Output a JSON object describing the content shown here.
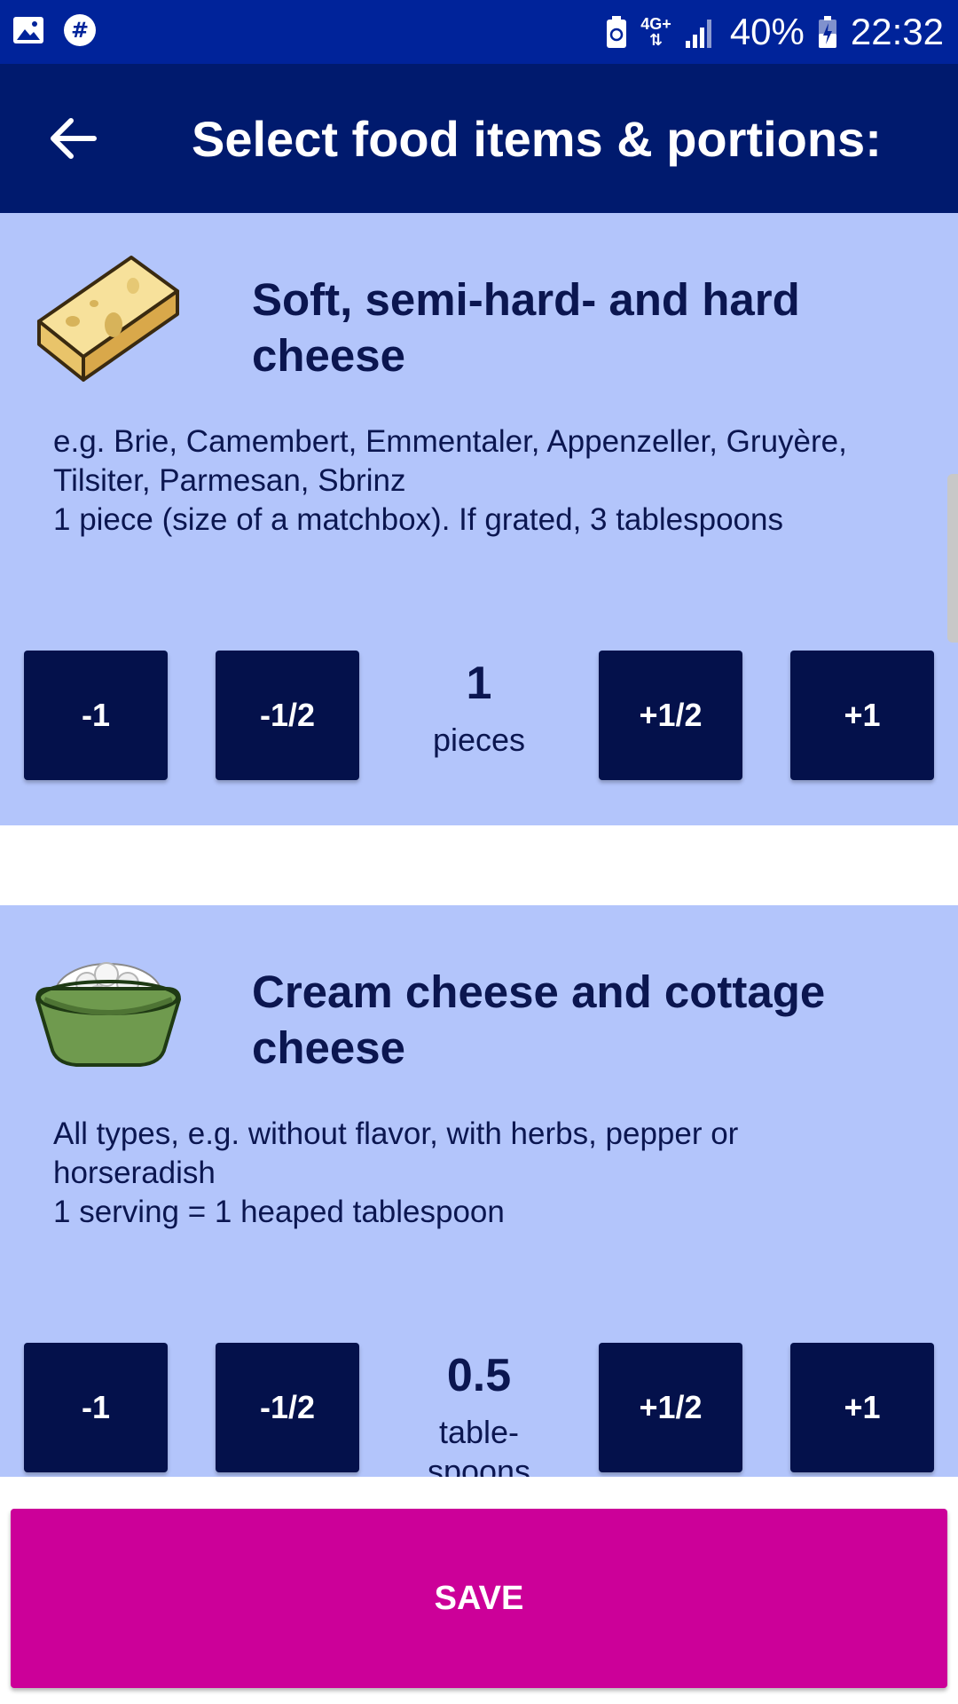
{
  "status_bar": {
    "network": "4G+",
    "battery": "40%",
    "time": "22:32",
    "icons": [
      "gallery-icon",
      "hashtag-app-icon",
      "battery-saver-icon",
      "signal-icon",
      "battery-charging-icon"
    ]
  },
  "app_bar": {
    "title": "Select food items & portions:",
    "back_icon": "arrow-left-icon"
  },
  "colors": {
    "status_bar": "#00239a",
    "app_bar": "#001a6e",
    "card_background": "#b3c5fb",
    "button": "#04114b",
    "save_button": "#cc0099",
    "text": "#0b1650"
  },
  "items": [
    {
      "title_line1": "Soft, semi-hard- and hard",
      "title_line2": "cheese",
      "image_icon": "cheese-icon",
      "desc_line1": "e.g. Brie, Camembert, Emmentaler, Appenzeller, Gruyère,",
      "desc_line2": "Tilsiter, Parmesan, Sbrinz",
      "desc_line3": "1 piece (size of a matchbox). If grated, 3 tablespoons",
      "value": "1",
      "unit": "pieces",
      "buttons": {
        "minus_one": "-1",
        "minus_half": "-1/2",
        "plus_half": "+1/2",
        "plus_one": "+1"
      }
    },
    {
      "title_line1": "Cream cheese and cottage",
      "title_line2": "cheese",
      "image_icon": "cottage-cheese-bowl-icon",
      "desc_line1": "All types, e.g. without flavor, with herbs, pepper or",
      "desc_line2": "horseradish",
      "desc_line3": "1 serving = 1 heaped tablespoon",
      "value": "0.5",
      "unit_line1": "table-",
      "unit_line2": "spoons",
      "buttons": {
        "minus_one": "-1",
        "minus_half": "-1/2",
        "plus_half": "+1/2",
        "plus_one": "+1"
      }
    }
  ],
  "save_label": "SAVE"
}
